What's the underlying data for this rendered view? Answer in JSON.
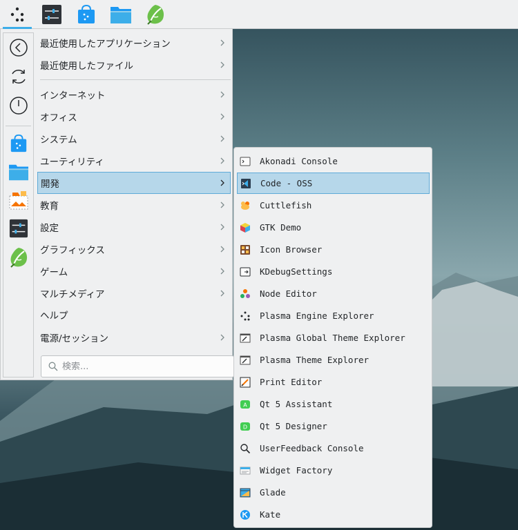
{
  "panel": {
    "launcher_icon": "application-launcher-icon",
    "tasks": [
      {
        "icon": "system-settings-icon"
      },
      {
        "icon": "discover-store-icon"
      },
      {
        "icon": "dolphin-folder-icon"
      },
      {
        "icon": "leaf-icon"
      }
    ]
  },
  "favorites": {
    "actions": [
      {
        "icon": "back-arrow-icon"
      },
      {
        "icon": "refresh-icon"
      },
      {
        "icon": "power-icon"
      }
    ],
    "apps": [
      {
        "icon": "discover-store-icon"
      },
      {
        "icon": "dolphin-folder-icon"
      },
      {
        "icon": "screenshot-icon"
      },
      {
        "icon": "system-settings-icon"
      },
      {
        "icon": "leaf-icon"
      }
    ]
  },
  "categories": [
    {
      "label": "最近使用したアプリケーション",
      "has_submenu": true
    },
    {
      "label": "最近使用したファイル",
      "has_submenu": true
    },
    {
      "label": "インターネット",
      "has_submenu": true
    },
    {
      "label": "オフィス",
      "has_submenu": true
    },
    {
      "label": "システム",
      "has_submenu": true
    },
    {
      "label": "ユーティリティ",
      "has_submenu": true
    },
    {
      "label": "開発",
      "has_submenu": true,
      "selected": true
    },
    {
      "label": "教育",
      "has_submenu": true
    },
    {
      "label": "設定",
      "has_submenu": true
    },
    {
      "label": "グラフィックス",
      "has_submenu": true
    },
    {
      "label": "ゲーム",
      "has_submenu": true
    },
    {
      "label": "マルチメディア",
      "has_submenu": true
    },
    {
      "label": "ヘルプ",
      "has_submenu": false
    },
    {
      "label": "電源/セッション",
      "has_submenu": true
    }
  ],
  "search": {
    "placeholder": "検索..."
  },
  "submenu": {
    "items": [
      {
        "label": "Akonadi Console",
        "icon": "terminal-icon"
      },
      {
        "label": "Code - OSS",
        "icon": "vscode-icon",
        "selected": true
      },
      {
        "label": "Cuttlefish",
        "icon": "cuttlefish-icon"
      },
      {
        "label": "GTK Demo",
        "icon": "gtk-cube-icon"
      },
      {
        "label": "Icon Browser",
        "icon": "icon-browser-icon"
      },
      {
        "label": "KDebugSettings",
        "icon": "debug-settings-icon"
      },
      {
        "label": "Node Editor",
        "icon": "node-editor-icon"
      },
      {
        "label": "Plasma Engine Explorer",
        "icon": "plasma-engine-icon"
      },
      {
        "label": "Plasma Global Theme Explorer",
        "icon": "theme-explorer-icon"
      },
      {
        "label": "Plasma Theme Explorer",
        "icon": "theme-explorer-icon"
      },
      {
        "label": "Print Editor",
        "icon": "print-editor-icon"
      },
      {
        "label": "Qt 5 Assistant",
        "icon": "qt-assistant-icon"
      },
      {
        "label": "Qt 5 Designer",
        "icon": "qt-designer-icon"
      },
      {
        "label": "UserFeedback Console",
        "icon": "magnifier-icon"
      },
      {
        "label": "Widget Factory",
        "icon": "widget-factory-icon"
      },
      {
        "label": "Glade",
        "icon": "glade-icon"
      },
      {
        "label": "Kate",
        "icon": "kate-icon"
      }
    ]
  },
  "colors": {
    "accent": "#3daee9",
    "selection_bg": "#b6d7ea",
    "selection_border": "#5eaad8",
    "panel_bg": "#eff0f1"
  }
}
